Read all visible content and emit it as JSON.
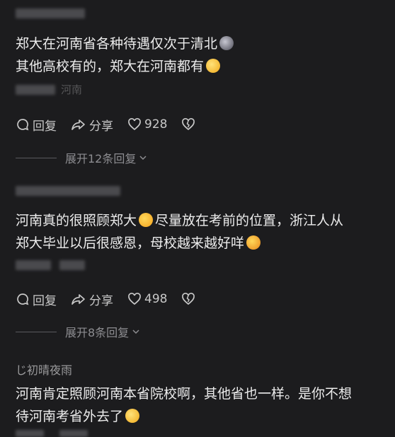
{
  "comments": [
    {
      "text_line1": "郑大在河南省各种待遇仅次于清北",
      "emoji_1": "smirk-cat-emoji",
      "text_line2": "其他高校有的，郑大在河南都有",
      "emoji_2": "sweat-smile-emoji",
      "meta_location": "河南",
      "reply_label": "回复",
      "share_label": "分享",
      "like_count": "928",
      "expand_label": "展开12条回复"
    },
    {
      "text_line1": "河南真的很照顾郑大",
      "emoji_1": "heart-hands-emoji",
      "text_line1_rest": "尽量放在考前的位置，浙江人从",
      "text_line2": "郑大毕业以后很感恩，母校越来越好咩",
      "emoji_2": "star-struck-emoji",
      "reply_label": "回复",
      "share_label": "分享",
      "like_count": "498",
      "expand_label": "展开8条回复"
    },
    {
      "username": "じ初晴夜雨",
      "text_line1": "河南肯定照顾河南本省院校啊，其他省也一样。是你不想",
      "text_line2": "待河南考省外去了",
      "emoji_2": "grin-sweat-emoji"
    }
  ],
  "colors": {
    "background": "#1c1c1e",
    "text": "#ececec",
    "muted": "#8d8d91",
    "action": "#c8c8c8"
  }
}
